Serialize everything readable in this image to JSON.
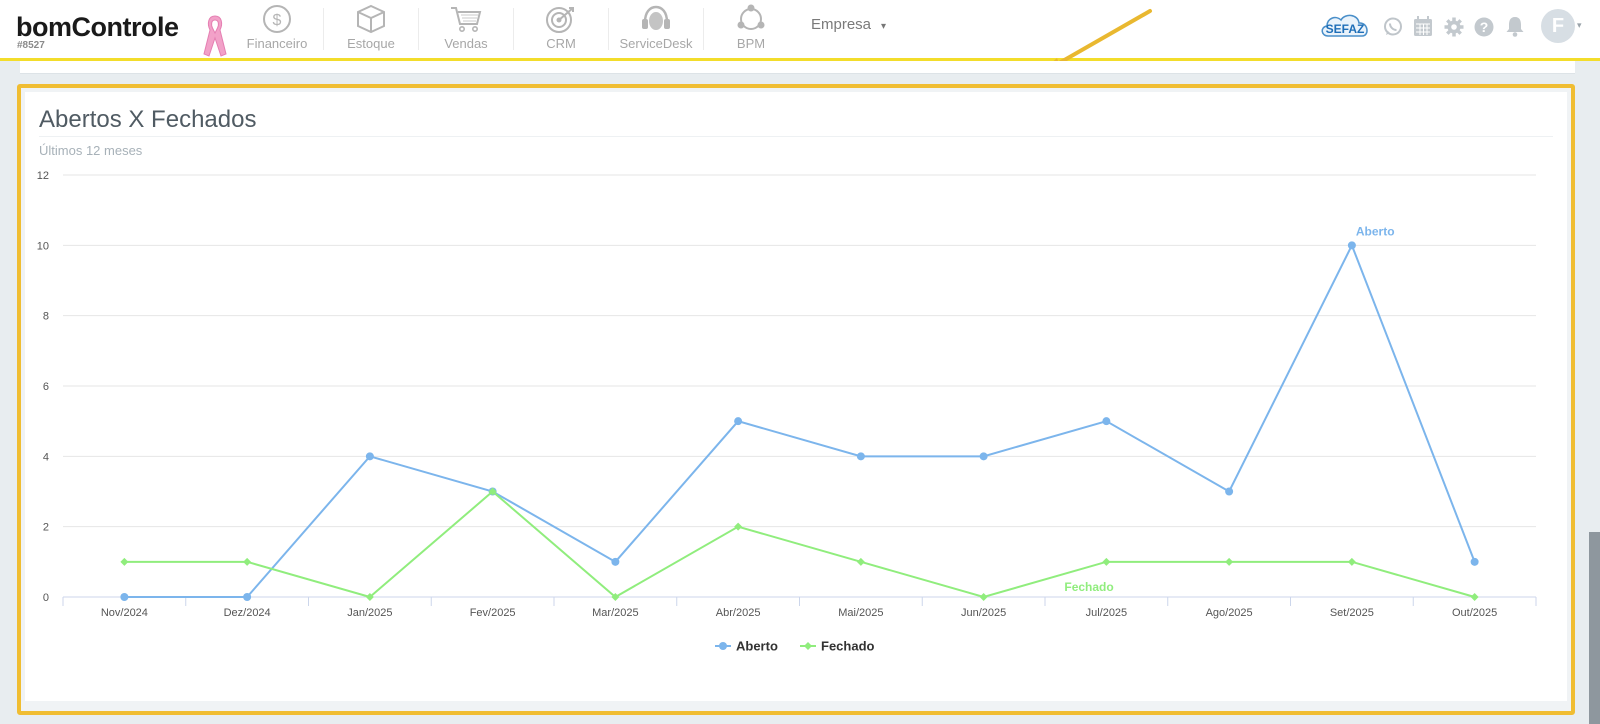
{
  "app": {
    "logo_text": "bomControle",
    "account_code": "#8527"
  },
  "nav": {
    "items": [
      {
        "label": "Financeiro",
        "icon": "dollar-coin-icon"
      },
      {
        "label": "Estoque",
        "icon": "box-icon"
      },
      {
        "label": "Vendas",
        "icon": "shopping-cart-icon"
      },
      {
        "label": "CRM",
        "icon": "target-icon"
      },
      {
        "label": "ServiceDesk",
        "icon": "headset-icon"
      },
      {
        "label": "BPM",
        "icon": "process-cycle-icon"
      }
    ],
    "company_label": "Empresa",
    "company_caret": "▾"
  },
  "header_right": {
    "sefaz_label": "SEFAZ",
    "avatar_initial": "F",
    "avatar_caret": "▾",
    "icons": [
      "whatsapp-icon",
      "calendar-icon",
      "gear-icon",
      "help-icon",
      "bell-icon"
    ]
  },
  "card": {
    "title": "Abertos X Fechados",
    "subtitle": "Últimos 12 meses"
  },
  "colors": {
    "aberto": "#7cb5ec",
    "fechado": "#90ed7d",
    "accent_border": "#f0bd32",
    "topbar_border": "#f3dd2b"
  },
  "chart_data": {
    "type": "line",
    "categories": [
      "Nov/2024",
      "Dez/2024",
      "Jan/2025",
      "Fev/2025",
      "Mar/2025",
      "Abr/2025",
      "Mai/2025",
      "Jun/2025",
      "Jul/2025",
      "Ago/2025",
      "Set/2025",
      "Out/2025"
    ],
    "series": [
      {
        "name": "Aberto",
        "values": [
          0,
          0,
          4,
          3,
          1,
          5,
          4,
          4,
          5,
          3,
          10,
          1
        ],
        "marker": "circle"
      },
      {
        "name": "Fechado",
        "values": [
          1,
          1,
          0,
          3,
          0,
          2,
          1,
          0,
          1,
          1,
          1,
          0
        ],
        "marker": "diamond"
      }
    ],
    "yticks": [
      0,
      2,
      4,
      6,
      8,
      10,
      12
    ],
    "ylim": [
      0,
      12
    ],
    "grid": true,
    "legend": "bottom-center",
    "series_labels": [
      {
        "series": "Aberto",
        "text": "Aberto"
      },
      {
        "series": "Fechado",
        "text": "Fechado"
      }
    ]
  }
}
